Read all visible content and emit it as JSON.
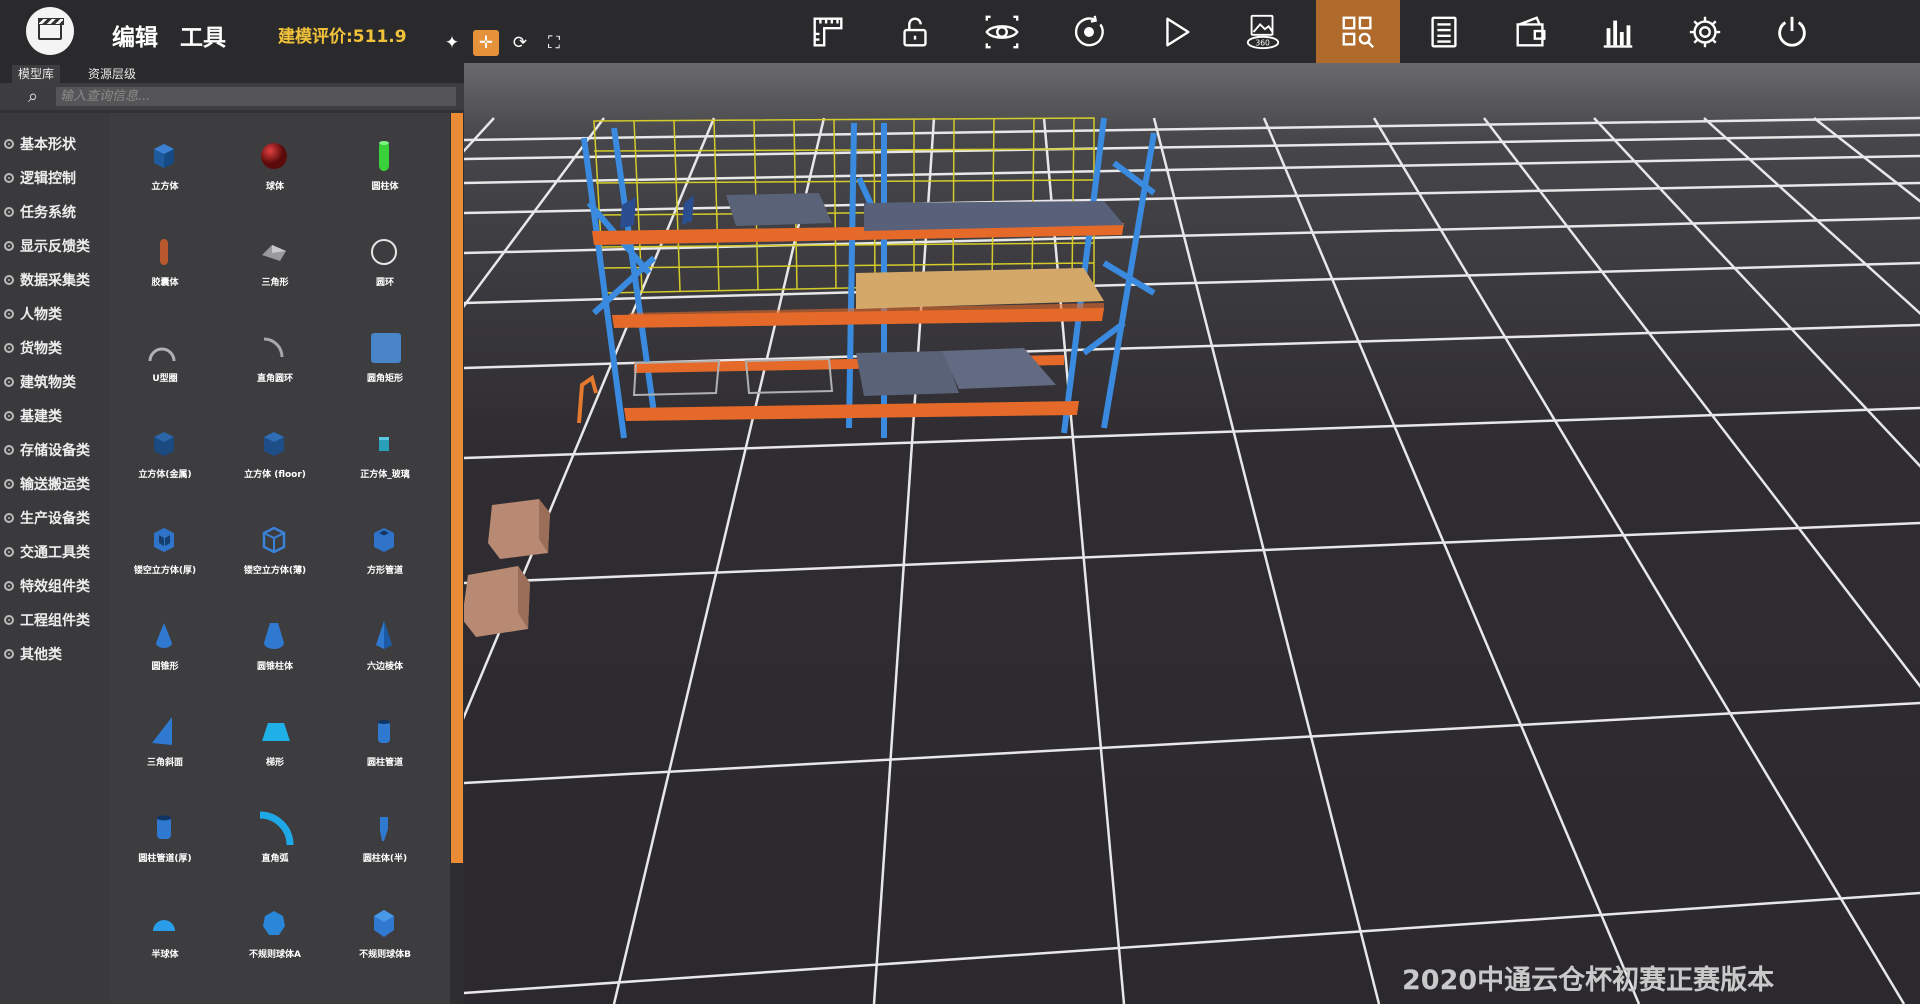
{
  "header": {
    "menu": [
      "编辑",
      "工具"
    ],
    "rating": "建模评价:511.9",
    "small_tools": [
      "sparkle-icon",
      "move-icon",
      "rotate-icon",
      "fullscreen-icon"
    ],
    "toolbar": [
      "ruler-icon",
      "unlock-icon",
      "eye-icon",
      "record-icon",
      "play-icon",
      "panorama-360-icon",
      "grid-view-icon",
      "list-icon",
      "wallet-icon",
      "chart-icon",
      "gear-icon",
      "power-icon"
    ],
    "active_toolbar": "grid-view-icon",
    "panorama_label": "360"
  },
  "panel": {
    "tabs": [
      "模型库",
      "资源层级"
    ],
    "search_placeholder": "输入查询信息...",
    "categories": [
      "基本形状",
      "逻辑控制",
      "任务系统",
      "显示反馈类",
      "数据采集类",
      "人物类",
      "货物类",
      "建筑物类",
      "基建类",
      "存储设备类",
      "输送搬运类",
      "生产设备类",
      "交通工具类",
      "特效组件类",
      "工程组件类",
      "其他类"
    ],
    "items": [
      {
        "label": "立方体",
        "shape": "cube-icon"
      },
      {
        "label": "球体",
        "shape": "sphere-icon"
      },
      {
        "label": "圆柱体",
        "shape": "cylinder-icon"
      },
      {
        "label": "胶囊体",
        "shape": "capsule-icon"
      },
      {
        "label": "三角形",
        "shape": "triangle-icon"
      },
      {
        "label": "圆环",
        "shape": "ring-icon"
      },
      {
        "label": "U型圈",
        "shape": "u-ring-icon"
      },
      {
        "label": "直角圆环",
        "shape": "quarter-ring-icon"
      },
      {
        "label": "圆角矩形",
        "shape": "rounded-rect-icon"
      },
      {
        "label": "立方体(金属)",
        "shape": "metal-cube-icon"
      },
      {
        "label": "立方体 (floor)",
        "shape": "floor-cube-icon"
      },
      {
        "label": "正方体_玻璃",
        "shape": "glass-cube-icon"
      },
      {
        "label": "镂空立方体(厚)",
        "shape": "hollow-cube-thick-icon"
      },
      {
        "label": "镂空立方体(薄)",
        "shape": "hollow-cube-thin-icon"
      },
      {
        "label": "方形管道",
        "shape": "square-pipe-icon"
      },
      {
        "label": "圆锥形",
        "shape": "cone-icon"
      },
      {
        "label": "圆锥柱体",
        "shape": "cone-cylinder-icon"
      },
      {
        "label": "六边棱体",
        "shape": "hex-pyramid-icon"
      },
      {
        "label": "三角斜面",
        "shape": "triangle-slope-icon"
      },
      {
        "label": "梯形",
        "shape": "trapezoid-icon"
      },
      {
        "label": "圆柱管道",
        "shape": "cylinder-pipe-icon"
      },
      {
        "label": "圆柱管道(厚)",
        "shape": "thick-pipe-icon"
      },
      {
        "label": "直角弧",
        "shape": "right-arc-icon"
      },
      {
        "label": "圆柱体(半)",
        "shape": "half-cylinder-icon"
      },
      {
        "label": "半球体",
        "shape": "hemisphere-icon"
      },
      {
        "label": "不规则球体A",
        "shape": "irregular-sphere-a-icon"
      },
      {
        "label": "不规则球体B",
        "shape": "irregular-sphere-b-icon"
      }
    ]
  },
  "watermark": "2020中通云仓杯初赛正赛版本",
  "colors": {
    "accent": "#e5923a",
    "rating": "#f2c23a",
    "shape_blue": "#2f6fb8"
  }
}
